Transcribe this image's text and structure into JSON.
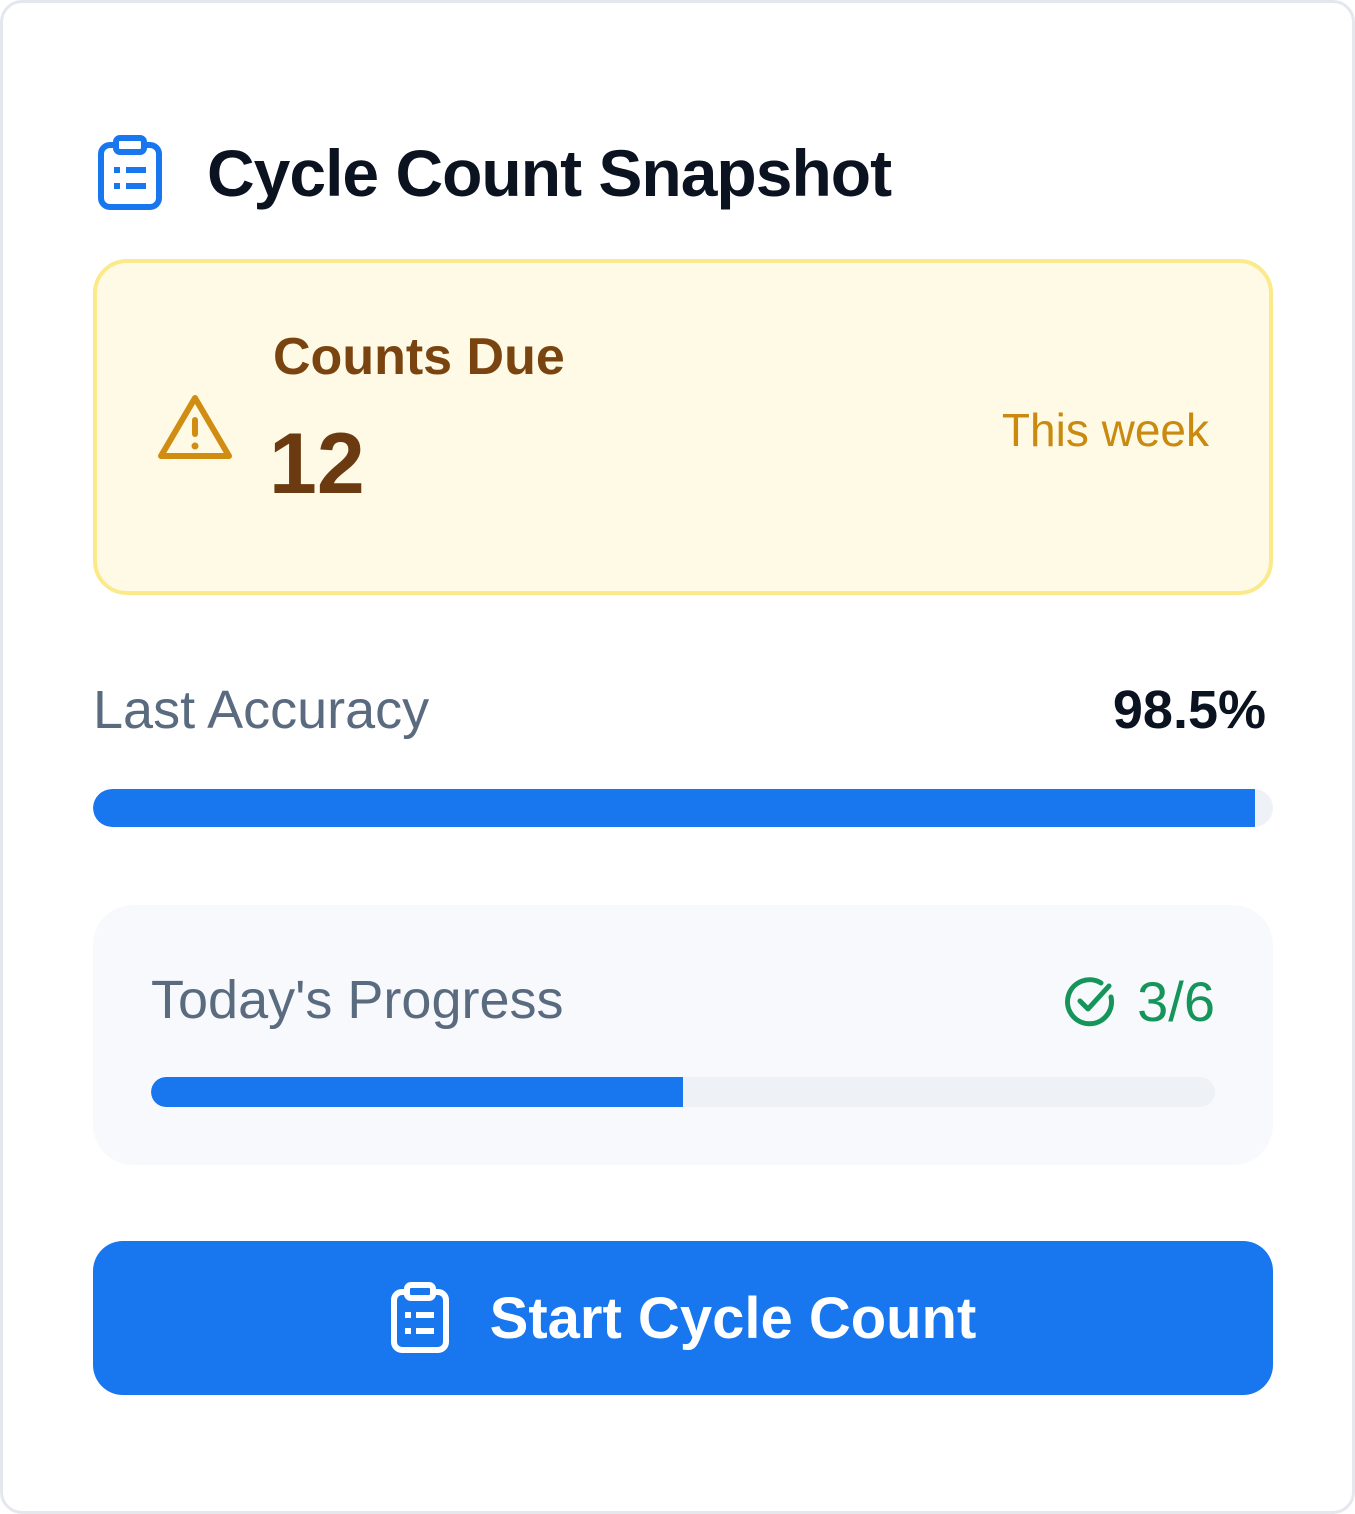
{
  "header": {
    "title": "Cycle Count Snapshot",
    "icon": "clipboard-list-icon"
  },
  "counts_due": {
    "title": "Counts Due",
    "value": "12",
    "period": "This week",
    "icon": "warning-triangle-icon"
  },
  "accuracy": {
    "label": "Last Accuracy",
    "value": "98.5%",
    "percent": 98.5
  },
  "todays_progress": {
    "label": "Today's Progress",
    "count": "3/6",
    "completed": 3,
    "total": 6,
    "icon": "check-circle-icon"
  },
  "start_button": {
    "label": "Start Cycle Count",
    "icon": "clipboard-list-icon"
  },
  "colors": {
    "primary": "#1877ee",
    "warning_bg": "#fefae6",
    "warning_border": "#fbe98a",
    "warning_text": "#7a4410",
    "success": "#16955b"
  }
}
